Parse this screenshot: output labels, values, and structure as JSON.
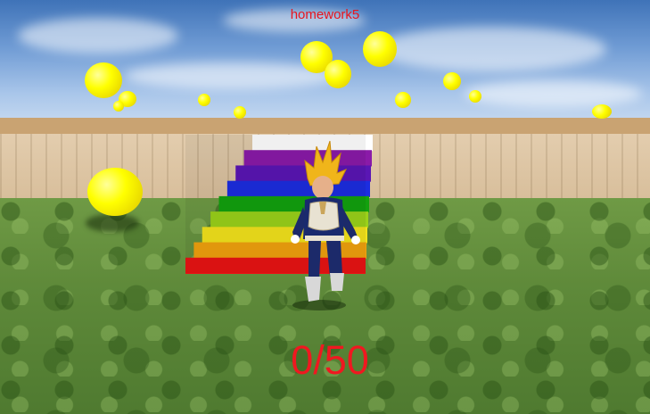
{
  "hud": {
    "title": "homework5",
    "score": "0/50",
    "color": "#e8141e"
  },
  "scene": {
    "stair_colors": [
      "#ffffff",
      "#8a1aa8",
      "#5a16b4",
      "#1c2de0",
      "#13a10e",
      "#9ad11a",
      "#f2e21c",
      "#f0a10e",
      "#e81414"
    ],
    "coin_color": "#ffff00",
    "character": "saiyan-warrior"
  }
}
